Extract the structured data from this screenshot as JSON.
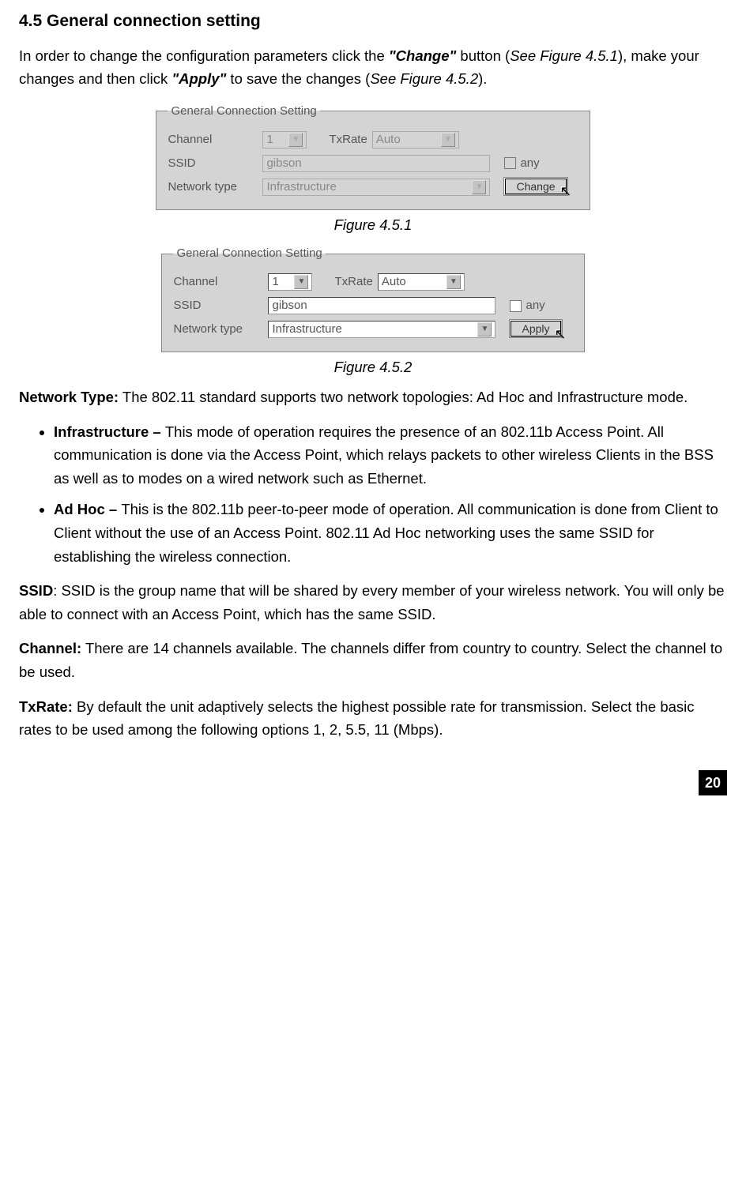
{
  "heading": "4.5  General connection setting",
  "intro_1": "In order to change the configuration parameters click the ",
  "intro_change": "\"Change\"",
  "intro_2": " button (",
  "intro_seefig1": "See Figure 4.5.1",
  "intro_3": "), make your changes and then click ",
  "intro_apply": "\"Apply\"",
  "intro_4": " to save the changes (",
  "intro_seefig2": "See Figure 4.5.2",
  "intro_5": ").",
  "dlg": {
    "legend": "General Connection Setting",
    "channel_label": "Channel",
    "channel_value": "1",
    "txrate_label": "TxRate",
    "txrate_value": "Auto",
    "ssid_label": "SSID",
    "ssid_value": "gibson",
    "any_label": "any",
    "nettype_label": "Network type",
    "nettype_value": "Infrastructure",
    "btn_change": "Change",
    "btn_apply": "Apply"
  },
  "caption1": "Figure 4.5.1",
  "caption2": "Figure 4.5.2",
  "nettype_head": "Network Type:",
  "nettype_text": " The 802.11 standard supports two network topologies: Ad Hoc and Infrastructure mode.",
  "infra_head": "Infrastructure – ",
  "infra_text": "This mode of operation requires the presence of an 802.11b Access Point. All communication is done via the Access Point, which relays packets to other wireless Clients in the BSS as well as to modes on a wired network such as Ethernet.",
  "adhoc_head": "Ad Hoc – ",
  "adhoc_text": "This is the 802.11b peer-to-peer mode of operation. All communication is done from Client to Client without the use of an Access Point. 802.11 Ad Hoc networking uses the same SSID for establishing the wireless connection.",
  "ssid_head": "SSID",
  "ssid_text": ": SSID is the group name that will be shared by every member of your wireless network. You will only be able to connect with an Access Point, which has the same SSID.",
  "channel_head": "Channel:",
  "channel_text": " There are 14 channels available. The channels differ from country to country. Select the channel to be used.",
  "txrate_head": "TxRate:",
  "txrate_text": " By default the unit adaptively selects the highest possible rate for transmission. Select the basic rates to be used among the following options 1, 2, 5.5, 11 (Mbps).",
  "page_number": "20"
}
